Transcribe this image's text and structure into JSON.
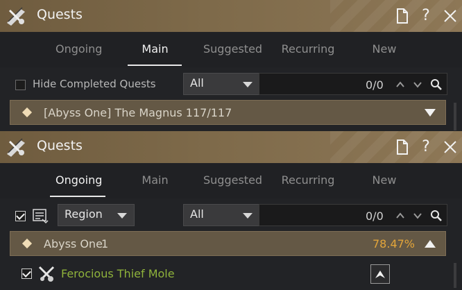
{
  "panels": [
    {
      "title": "Quests",
      "tabs": [
        "Ongoing",
        "Main",
        "Suggested",
        "Recurring",
        "New"
      ],
      "active_tab": "Main",
      "hide_completed": {
        "label": "Hide Completed Quests",
        "checked": false
      },
      "filter": {
        "selected": "All"
      },
      "counter": "0/0",
      "quest_group": {
        "label": "[Abyss One] The Magnus 117/117",
        "expanded": false
      }
    },
    {
      "title": "Quests",
      "tabs": [
        "Ongoing",
        "Main",
        "Suggested",
        "Recurring",
        "New"
      ],
      "active_tab": "Ongoing",
      "show_all_checked": true,
      "sort": {
        "selected": "Region"
      },
      "filter": {
        "selected": "All"
      },
      "counter": "0/0",
      "quest_group": {
        "label": "Abyss One",
        "count": "1",
        "progress": "78.47%",
        "expanded": true
      },
      "quests": [
        {
          "name": "Ferocious Thief Mole",
          "checked": true
        }
      ]
    }
  ],
  "icons": {
    "title": "scroll-quill-icon",
    "detach": "document-icon",
    "help": "help-icon",
    "close": "close-icon",
    "search": "search-icon",
    "prev": "chevron-up-icon",
    "next": "chevron-down-icon",
    "navigate": "navigate-icon"
  },
  "colors": {
    "titlebar": "#7e6a4a",
    "group_bar": "#645845",
    "progress_text": "#e3a53a",
    "quest_name": "#8fb33b"
  }
}
